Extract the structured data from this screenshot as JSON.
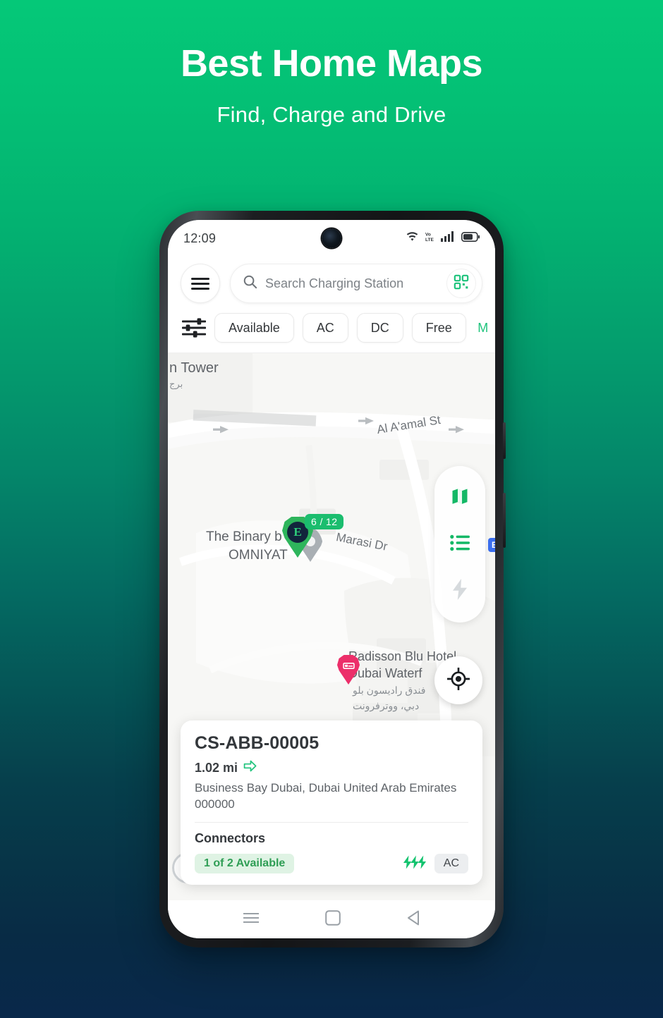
{
  "hero": {
    "title": "Best Home Maps",
    "subtitle": "Find, Charge and Drive"
  },
  "colors": {
    "gradient_top": "#05c878",
    "gradient_bottom": "#09284a",
    "accent_green": "#1bbd6e",
    "marker_green": "#2eb55c",
    "hotel_pink": "#ec2f6a",
    "badge_bg": "#dff3e4",
    "badge_text": "#2f9e55",
    "route_blue": "#3b6ff0"
  },
  "statusbar": {
    "time": "12:09",
    "icons": [
      "wifi-icon",
      "volte-icon",
      "cellular-signal-icon",
      "battery-icon"
    ],
    "volte_label": "VoLTE"
  },
  "search": {
    "menu_icon": "hamburger-menu-icon",
    "search_icon": "search-icon",
    "placeholder": "Search Charging Station",
    "value": "",
    "qr_icon": "qr-scan-icon"
  },
  "filters": {
    "tune_icon": "filter-sliders-icon",
    "chips": [
      {
        "label": "Available",
        "active": false
      },
      {
        "label": "AC",
        "active": false
      },
      {
        "label": "DC",
        "active": false
      },
      {
        "label": "Free",
        "active": false
      },
      {
        "label": "M",
        "active": true,
        "truncated": true
      }
    ]
  },
  "map": {
    "labels": [
      {
        "text": "n Tower",
        "sub": "برج"
      },
      {
        "text": "Al A'amal St"
      },
      {
        "text": "The Binary b"
      },
      {
        "text": "OMNIYAT"
      },
      {
        "text": "Marasi Dr"
      },
      {
        "text": "Radisson Blu Hotel,"
      },
      {
        "text": "Dubai Waterf"
      },
      {
        "text": "فندق راديسون بلو"
      },
      {
        "text": "دبي، ووترفرونت"
      }
    ],
    "cluster": {
      "badge": "6 / 12",
      "logo_glyph": "E",
      "icon": "charging-station-pin-icon"
    },
    "hotel_marker": {
      "icon": "hotel-bed-pin-icon",
      "name": "Radisson Blu Hotel, Dubai Waterfront"
    },
    "route_badge": "E",
    "controls": [
      {
        "name": "map-layer-button",
        "icon": "map-icon",
        "active": true
      },
      {
        "name": "list-view-button",
        "icon": "list-icon",
        "active": true
      },
      {
        "name": "charge-filter-button",
        "icon": "lightning-bolt-icon",
        "active": false
      }
    ],
    "locate_button": {
      "icon": "my-location-icon"
    }
  },
  "station_card": {
    "title": "CS-ABB-00005",
    "distance": "1.02 mi",
    "direction_icon": "navigate-arrow-icon",
    "address": "Business Bay Dubai, Dubai United Arab Emirates 000000",
    "connectors_label": "Connectors",
    "availability": "1 of 2 Available",
    "power_icon": "triple-bolt-icon",
    "current_type": "AC"
  },
  "navbar": {
    "items": [
      {
        "name": "recents-button",
        "icon": "recents-icon"
      },
      {
        "name": "home-button",
        "icon": "home-square-icon"
      },
      {
        "name": "back-button",
        "icon": "back-triangle-icon"
      }
    ]
  }
}
